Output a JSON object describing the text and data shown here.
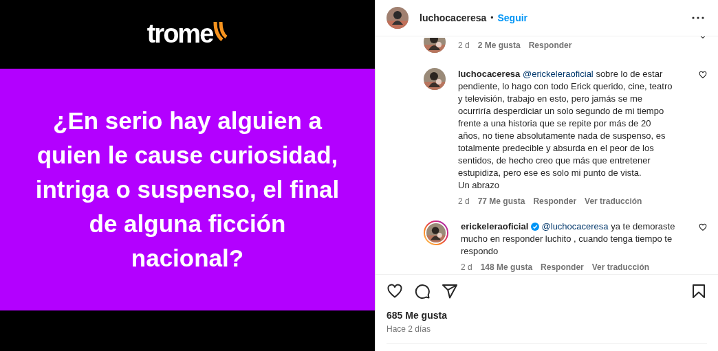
{
  "post_image": {
    "logo": "trome",
    "headline": "¿En serio hay alguien a quien le cause curiosidad, intriga o suspenso, el final de alguna ficción nacional?"
  },
  "header": {
    "username": "luchocaceresa",
    "separator": "•",
    "follow": "Seguir"
  },
  "comments": [
    {
      "kind": "cut",
      "time": "2 d",
      "likes": "2 Me gusta",
      "reply": "Responder"
    },
    {
      "kind": "full",
      "username": "luchocaceresa",
      "verified": false,
      "story_ring": false,
      "mention": "@erickeleraoficial",
      "text": "sobre lo de estar pendiente, lo hago con todo Erick querido, cine, teatro y televisión, trabajo en esto, pero jamás se me ocurriría desperdiciar un solo segundo de mi tiempo frente a una historia que se repite por más de 20 años, no tiene absolutamente nada de suspenso, es totalmente predecible y absurda en el peor de los sentidos, de hecho creo que más que entretener estupidiza, pero ese es solo mi punto de vista.\nUn abrazo",
      "time": "2 d",
      "likes": "77 Me gusta",
      "reply": "Responder",
      "translate": "Ver traducción"
    },
    {
      "kind": "full",
      "username": "erickeleraoficial",
      "verified": true,
      "story_ring": true,
      "mention": "@luchocaceresa",
      "text": "ya te demoraste mucho en responder luchito , cuando tenga tiempo te respondo",
      "time": "2 d",
      "likes": "148 Me gusta",
      "reply": "Responder",
      "translate": "Ver traducción"
    }
  ],
  "likes": "685 Me gusta",
  "posted": "Hace 2 días"
}
